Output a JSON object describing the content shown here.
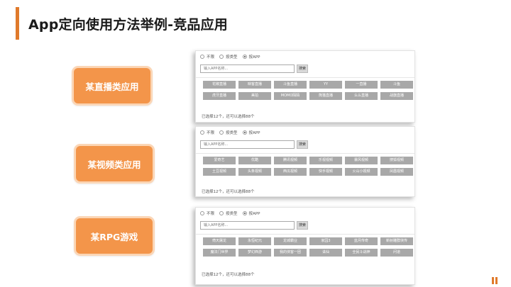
{
  "slide": {
    "title": "App定向使用方法举例-竞品应用"
  },
  "categories": [
    {
      "label": "某直播类应用"
    },
    {
      "label": "某视频类应用"
    },
    {
      "label": "某RPG游戏"
    }
  ],
  "panels": [
    {
      "radios": [
        "不限",
        "按类型",
        "按APP"
      ],
      "selected_radio": "按APP",
      "search_placeholder": "输入APP名称...",
      "search_button": "搜索",
      "tags": [
        "花椒直播",
        "映客直播",
        "斗鱼直播",
        "YY",
        "一直播",
        "斗鱼",
        "虎牙直播",
        "美拍",
        "MOMO陌陌",
        "熊猫直播",
        "么么直播",
        "战旗直播"
      ],
      "footer": "已选择12个，还可以选择88个"
    },
    {
      "radios": [
        "不限",
        "按类型",
        "按APP"
      ],
      "selected_radio": "按APP",
      "search_placeholder": "输入APP名称...",
      "search_button": "搜索",
      "tags": [
        "爱奇艺",
        "优酷",
        "腾讯视频",
        "乐视视频",
        "暴风视频",
        "搜狐视频",
        "土豆视频",
        "头条视频",
        "西瓜视频",
        "快手视频",
        "火山小视频",
        "凤凰视频"
      ],
      "footer": "已选择12个，还可以选择88个"
    },
    {
      "radios": [
        "不限",
        "按类型",
        "按APP"
      ],
      "selected_radio": "按APP",
      "search_placeholder": "输入APP名称...",
      "search_button": "搜索",
      "tags": [
        "倚天屠龙",
        "永恒纪元",
        "龙城霸业",
        "家园3",
        "蓝月传奇",
        "新射雕群侠传",
        "魔法门世界",
        "梦幻西游",
        "我的侠客一团",
        "诛仙",
        "全民斗战神",
        "问道"
      ],
      "footer": "已选择12个，还可以选择88个"
    }
  ],
  "colors": {
    "accent": "#e07a2b",
    "button_fill": "#f3954a",
    "tag_fill": "#a8a8a8"
  }
}
